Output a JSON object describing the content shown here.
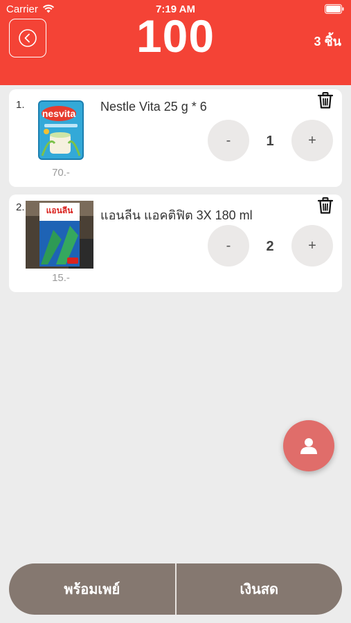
{
  "status": {
    "carrier": "Carrier",
    "time": "7:19 AM"
  },
  "header": {
    "total": "100",
    "count": "3 ชิ้น"
  },
  "items": [
    {
      "index": "1.",
      "name": "Nestle Vita 25 g * 6",
      "price": "70.-",
      "quantity": "1",
      "minus": "-",
      "plus": "+"
    },
    {
      "index": "2.",
      "name": "แอนลีน แอคติฟิต 3X 180 ml",
      "price": "15.-",
      "quantity": "2",
      "minus": "-",
      "plus": "+"
    }
  ],
  "product_image_text": {
    "nesvita": "nesvita",
    "anlene": "แอนลีน"
  },
  "payment": {
    "promptpay": "พร้อมเพย์",
    "cash": "เงินสด"
  },
  "colors": {
    "header": "#f44336",
    "fab": "#e06d6a",
    "pay_bar": "#857870"
  }
}
